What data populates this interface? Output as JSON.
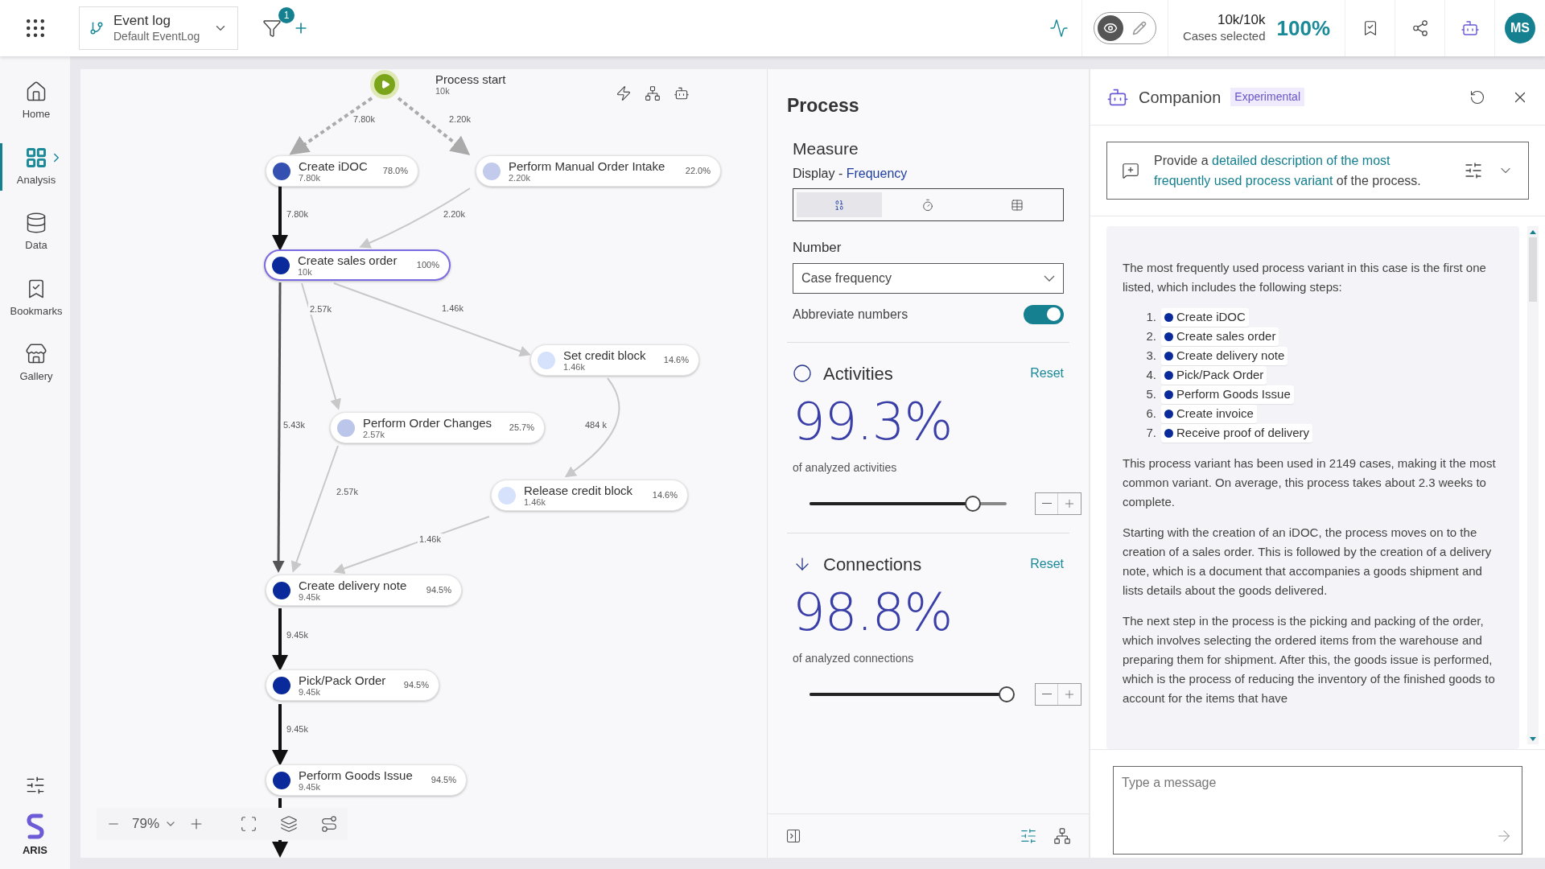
{
  "topbar": {
    "source": {
      "title": "Event log",
      "subtitle": "Default EventLog"
    },
    "filter_badge": "1",
    "view_modes": [
      {
        "kind": "view",
        "selected": true
      },
      {
        "kind": "edit",
        "selected": false
      }
    ],
    "cases": {
      "count": "10k/10k",
      "label": "Cases selected",
      "percent": "100%"
    },
    "avatar": "MS"
  },
  "sidebar": {
    "items": [
      {
        "kind": "home",
        "label": "Home",
        "selected": false
      },
      {
        "kind": "analysis",
        "label": "Analysis",
        "selected": true
      },
      {
        "kind": "data",
        "label": "Data",
        "selected": false
      },
      {
        "kind": "bookmarks",
        "label": "Bookmarks",
        "selected": false
      },
      {
        "kind": "gallery",
        "label": "Gallery",
        "selected": false
      }
    ],
    "logo": "ARIS"
  },
  "process_map": {
    "start": {
      "label": "Process start",
      "count": "10k"
    },
    "nodes": [
      {
        "name": "Create iDOC",
        "count": "7.80k",
        "percent": "78.0%",
        "color": "#3451b2",
        "selected": false
      },
      {
        "name": "Perform Manual Order Intake",
        "count": "2.20k",
        "percent": "22.0%",
        "color": "#c3cbec",
        "selected": false
      },
      {
        "name": "Create sales order",
        "count": "10k",
        "percent": "100%",
        "color": "#0a2a9c",
        "selected": true
      },
      {
        "name": "Set credit block",
        "count": "1.46k",
        "percent": "14.6%",
        "color": "#d6e2fb",
        "selected": false
      },
      {
        "name": "Perform Order Changes",
        "count": "2.57k",
        "percent": "25.7%",
        "color": "#bcc5ea",
        "selected": false
      },
      {
        "name": "Release credit block",
        "count": "1.46k",
        "percent": "14.6%",
        "color": "#d6e2fb",
        "selected": false
      },
      {
        "name": "Create delivery note",
        "count": "9.45k",
        "percent": "94.5%",
        "color": "#0a2a9c",
        "selected": false
      },
      {
        "name": "Pick/Pack Order",
        "count": "9.45k",
        "percent": "94.5%",
        "color": "#0a2a9c",
        "selected": false
      },
      {
        "name": "Perform Goods Issue",
        "count": "9.45k",
        "percent": "94.5%",
        "color": "#0a2a9c",
        "selected": false
      }
    ],
    "edges": [
      {
        "label": "7.80k",
        "kind": "dashed"
      },
      {
        "label": "2.20k",
        "kind": "dashed"
      },
      {
        "label": "7.80k",
        "kind": "heavy"
      },
      {
        "label": "2.20k",
        "kind": "light"
      },
      {
        "label": "1.46k",
        "kind": "light"
      },
      {
        "label": "2.57k",
        "kind": "light"
      },
      {
        "label": "5.43k",
        "kind": "medium"
      },
      {
        "label": "484 k",
        "kind": "light"
      },
      {
        "label": "2.57k",
        "kind": "light"
      },
      {
        "label": "1.46k",
        "kind": "light"
      },
      {
        "label": "9.45k",
        "kind": "heavy"
      },
      {
        "label": "9.45k",
        "kind": "heavy"
      }
    ],
    "zoom": "79%"
  },
  "process_panel": {
    "title": "Process",
    "measure": {
      "heading": "Measure",
      "display_label": "Display - ",
      "display_value": "Frequency",
      "modes": [
        {
          "kind": "number",
          "selected": true
        },
        {
          "kind": "time",
          "selected": false
        },
        {
          "kind": "table",
          "selected": false
        }
      ],
      "number_label": "Number",
      "number_value": "Case frequency",
      "abbreviate": {
        "label": "Abbreviate numbers",
        "on": true
      }
    },
    "sections": [
      {
        "kind": "activities",
        "title": "Activities",
        "reset": "Reset",
        "value": "99.3%",
        "caption": "of analyzed activities",
        "level": 0.83
      },
      {
        "kind": "connections",
        "title": "Connections",
        "reset": "Reset",
        "value": "98.8%",
        "caption": "of analyzed connections",
        "level": 1
      }
    ]
  },
  "companion": {
    "title": "Companion",
    "badge": "Experimental",
    "prompt": "Provide a **detailed description of the most frequently used process variant** of the process.",
    "response": {
      "intro": "The most frequently used process variant in this case is the first one listed, which includes the following steps:",
      "steps": [
        {
          "number": "1.",
          "label": "Create iDOC"
        },
        {
          "number": "2.",
          "label": "Create sales order"
        },
        {
          "number": "3.",
          "label": "Create delivery note"
        },
        {
          "number": "4.",
          "label": "Pick/Pack Order"
        },
        {
          "number": "5.",
          "label": "Perform Goods Issue"
        },
        {
          "number": "6.",
          "label": "Create invoice"
        },
        {
          "number": "7.",
          "label": "Receive proof of delivery"
        }
      ],
      "paragraphs": [
        "This process variant has been used in 2149 cases, making it the most common variant. On average, this process takes about 2.3 weeks to complete.",
        "Starting with the creation of an iDOC, the process moves on to the creation of a sales order. This is followed by the creation of a delivery note, which is a document that accompanies a goods shipment and lists details about the goods delivered.",
        "The next step in the process is the picking and packing of the order, which involves selecting the ordered items from the warehouse and preparing them for shipment. After this, the goods issue is performed, which is the process of reducing the inventory of the finished goods to account for the items that have"
      ]
    },
    "message": {
      "placeholder": "Type a message"
    }
  }
}
